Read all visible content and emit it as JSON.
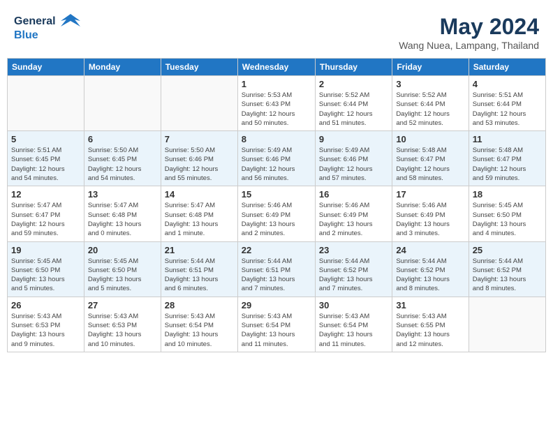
{
  "header": {
    "logo_line1": "General",
    "logo_line2": "Blue",
    "month": "May 2024",
    "location": "Wang Nuea, Lampang, Thailand"
  },
  "weekdays": [
    "Sunday",
    "Monday",
    "Tuesday",
    "Wednesday",
    "Thursday",
    "Friday",
    "Saturday"
  ],
  "weeks": [
    {
      "alt": false,
      "days": [
        {
          "num": "",
          "info": ""
        },
        {
          "num": "",
          "info": ""
        },
        {
          "num": "",
          "info": ""
        },
        {
          "num": "1",
          "info": "Sunrise: 5:53 AM\nSunset: 6:43 PM\nDaylight: 12 hours\nand 50 minutes."
        },
        {
          "num": "2",
          "info": "Sunrise: 5:52 AM\nSunset: 6:44 PM\nDaylight: 12 hours\nand 51 minutes."
        },
        {
          "num": "3",
          "info": "Sunrise: 5:52 AM\nSunset: 6:44 PM\nDaylight: 12 hours\nand 52 minutes."
        },
        {
          "num": "4",
          "info": "Sunrise: 5:51 AM\nSunset: 6:44 PM\nDaylight: 12 hours\nand 53 minutes."
        }
      ]
    },
    {
      "alt": true,
      "days": [
        {
          "num": "5",
          "info": "Sunrise: 5:51 AM\nSunset: 6:45 PM\nDaylight: 12 hours\nand 54 minutes."
        },
        {
          "num": "6",
          "info": "Sunrise: 5:50 AM\nSunset: 6:45 PM\nDaylight: 12 hours\nand 54 minutes."
        },
        {
          "num": "7",
          "info": "Sunrise: 5:50 AM\nSunset: 6:46 PM\nDaylight: 12 hours\nand 55 minutes."
        },
        {
          "num": "8",
          "info": "Sunrise: 5:49 AM\nSunset: 6:46 PM\nDaylight: 12 hours\nand 56 minutes."
        },
        {
          "num": "9",
          "info": "Sunrise: 5:49 AM\nSunset: 6:46 PM\nDaylight: 12 hours\nand 57 minutes."
        },
        {
          "num": "10",
          "info": "Sunrise: 5:48 AM\nSunset: 6:47 PM\nDaylight: 12 hours\nand 58 minutes."
        },
        {
          "num": "11",
          "info": "Sunrise: 5:48 AM\nSunset: 6:47 PM\nDaylight: 12 hours\nand 59 minutes."
        }
      ]
    },
    {
      "alt": false,
      "days": [
        {
          "num": "12",
          "info": "Sunrise: 5:47 AM\nSunset: 6:47 PM\nDaylight: 12 hours\nand 59 minutes."
        },
        {
          "num": "13",
          "info": "Sunrise: 5:47 AM\nSunset: 6:48 PM\nDaylight: 13 hours\nand 0 minutes."
        },
        {
          "num": "14",
          "info": "Sunrise: 5:47 AM\nSunset: 6:48 PM\nDaylight: 13 hours\nand 1 minute."
        },
        {
          "num": "15",
          "info": "Sunrise: 5:46 AM\nSunset: 6:49 PM\nDaylight: 13 hours\nand 2 minutes."
        },
        {
          "num": "16",
          "info": "Sunrise: 5:46 AM\nSunset: 6:49 PM\nDaylight: 13 hours\nand 2 minutes."
        },
        {
          "num": "17",
          "info": "Sunrise: 5:46 AM\nSunset: 6:49 PM\nDaylight: 13 hours\nand 3 minutes."
        },
        {
          "num": "18",
          "info": "Sunrise: 5:45 AM\nSunset: 6:50 PM\nDaylight: 13 hours\nand 4 minutes."
        }
      ]
    },
    {
      "alt": true,
      "days": [
        {
          "num": "19",
          "info": "Sunrise: 5:45 AM\nSunset: 6:50 PM\nDaylight: 13 hours\nand 5 minutes."
        },
        {
          "num": "20",
          "info": "Sunrise: 5:45 AM\nSunset: 6:50 PM\nDaylight: 13 hours\nand 5 minutes."
        },
        {
          "num": "21",
          "info": "Sunrise: 5:44 AM\nSunset: 6:51 PM\nDaylight: 13 hours\nand 6 minutes."
        },
        {
          "num": "22",
          "info": "Sunrise: 5:44 AM\nSunset: 6:51 PM\nDaylight: 13 hours\nand 7 minutes."
        },
        {
          "num": "23",
          "info": "Sunrise: 5:44 AM\nSunset: 6:52 PM\nDaylight: 13 hours\nand 7 minutes."
        },
        {
          "num": "24",
          "info": "Sunrise: 5:44 AM\nSunset: 6:52 PM\nDaylight: 13 hours\nand 8 minutes."
        },
        {
          "num": "25",
          "info": "Sunrise: 5:44 AM\nSunset: 6:52 PM\nDaylight: 13 hours\nand 8 minutes."
        }
      ]
    },
    {
      "alt": false,
      "days": [
        {
          "num": "26",
          "info": "Sunrise: 5:43 AM\nSunset: 6:53 PM\nDaylight: 13 hours\nand 9 minutes."
        },
        {
          "num": "27",
          "info": "Sunrise: 5:43 AM\nSunset: 6:53 PM\nDaylight: 13 hours\nand 10 minutes."
        },
        {
          "num": "28",
          "info": "Sunrise: 5:43 AM\nSunset: 6:54 PM\nDaylight: 13 hours\nand 10 minutes."
        },
        {
          "num": "29",
          "info": "Sunrise: 5:43 AM\nSunset: 6:54 PM\nDaylight: 13 hours\nand 11 minutes."
        },
        {
          "num": "30",
          "info": "Sunrise: 5:43 AM\nSunset: 6:54 PM\nDaylight: 13 hours\nand 11 minutes."
        },
        {
          "num": "31",
          "info": "Sunrise: 5:43 AM\nSunset: 6:55 PM\nDaylight: 13 hours\nand 12 minutes."
        },
        {
          "num": "",
          "info": ""
        }
      ]
    }
  ]
}
